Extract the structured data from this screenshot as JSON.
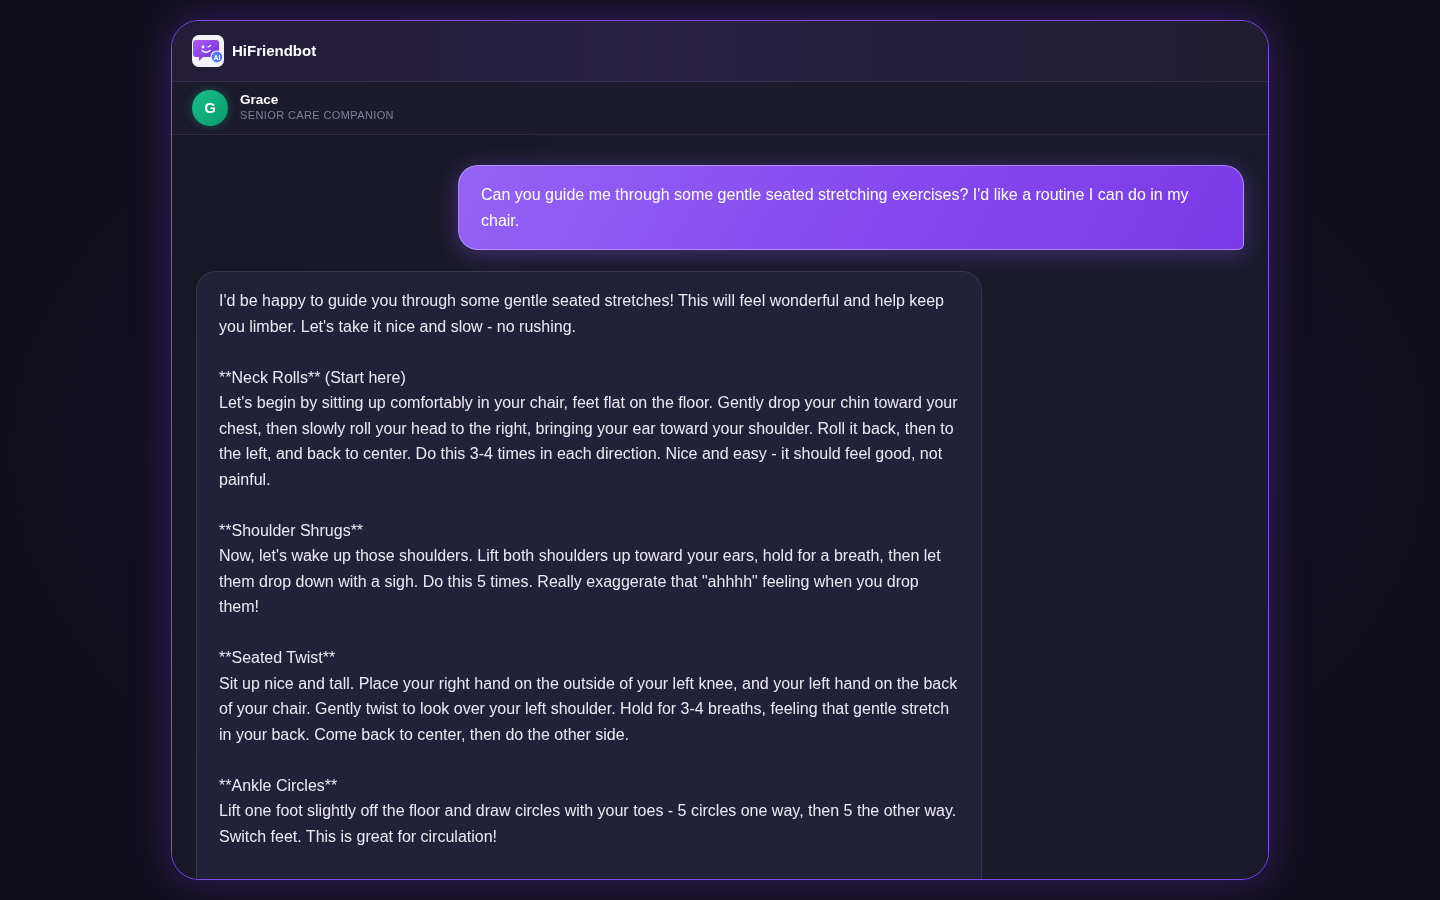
{
  "app": {
    "name": "HiFriendbot",
    "logo_badge": "AI"
  },
  "contact": {
    "initial": "G",
    "name": "Grace",
    "role": "SENIOR CARE COMPANION"
  },
  "messages": [
    {
      "kind": "user",
      "paragraphs": [
        {
          "body": "Can you guide me through some gentle seated stretching exercises? I'd like a routine I can do in my chair."
        }
      ]
    },
    {
      "kind": "assistant",
      "paragraphs": [
        {
          "body": "I'd be happy to guide you through some gentle seated stretches! This will feel wonderful and help keep you limber. Let's take it nice and slow - no rushing."
        },
        {
          "heading": "**Neck Rolls** (Start here)",
          "body": "Let's begin by sitting up comfortably in your chair, feet flat on the floor. Gently drop your chin toward your chest, then slowly roll your head to the right, bringing your ear toward your shoulder. Roll it back, then to the left, and back to center. Do this 3-4 times in each direction. Nice and easy - it should feel good, not painful."
        },
        {
          "heading": "**Shoulder Shrugs**",
          "body": "Now, let's wake up those shoulders. Lift both shoulders up toward your ears, hold for a breath, then let them drop down with a sigh. Do this 5 times. Really exaggerate that \"ahhhh\" feeling when you drop them!"
        },
        {
          "heading": "**Seated Twist**",
          "body": "Sit up nice and tall. Place your right hand on the outside of your left knee, and your left hand on the back of your chair. Gently twist to look over your left shoulder. Hold for 3-4 breaths, feeling that gentle stretch in your back. Come back to center, then do the other side."
        },
        {
          "heading": "**Ankle Circles**",
          "body": "Lift one foot slightly off the floor and draw circles with your toes - 5 circles one way, then 5 the other way. Switch feet. This is great for circulation!"
        }
      ]
    }
  ]
}
